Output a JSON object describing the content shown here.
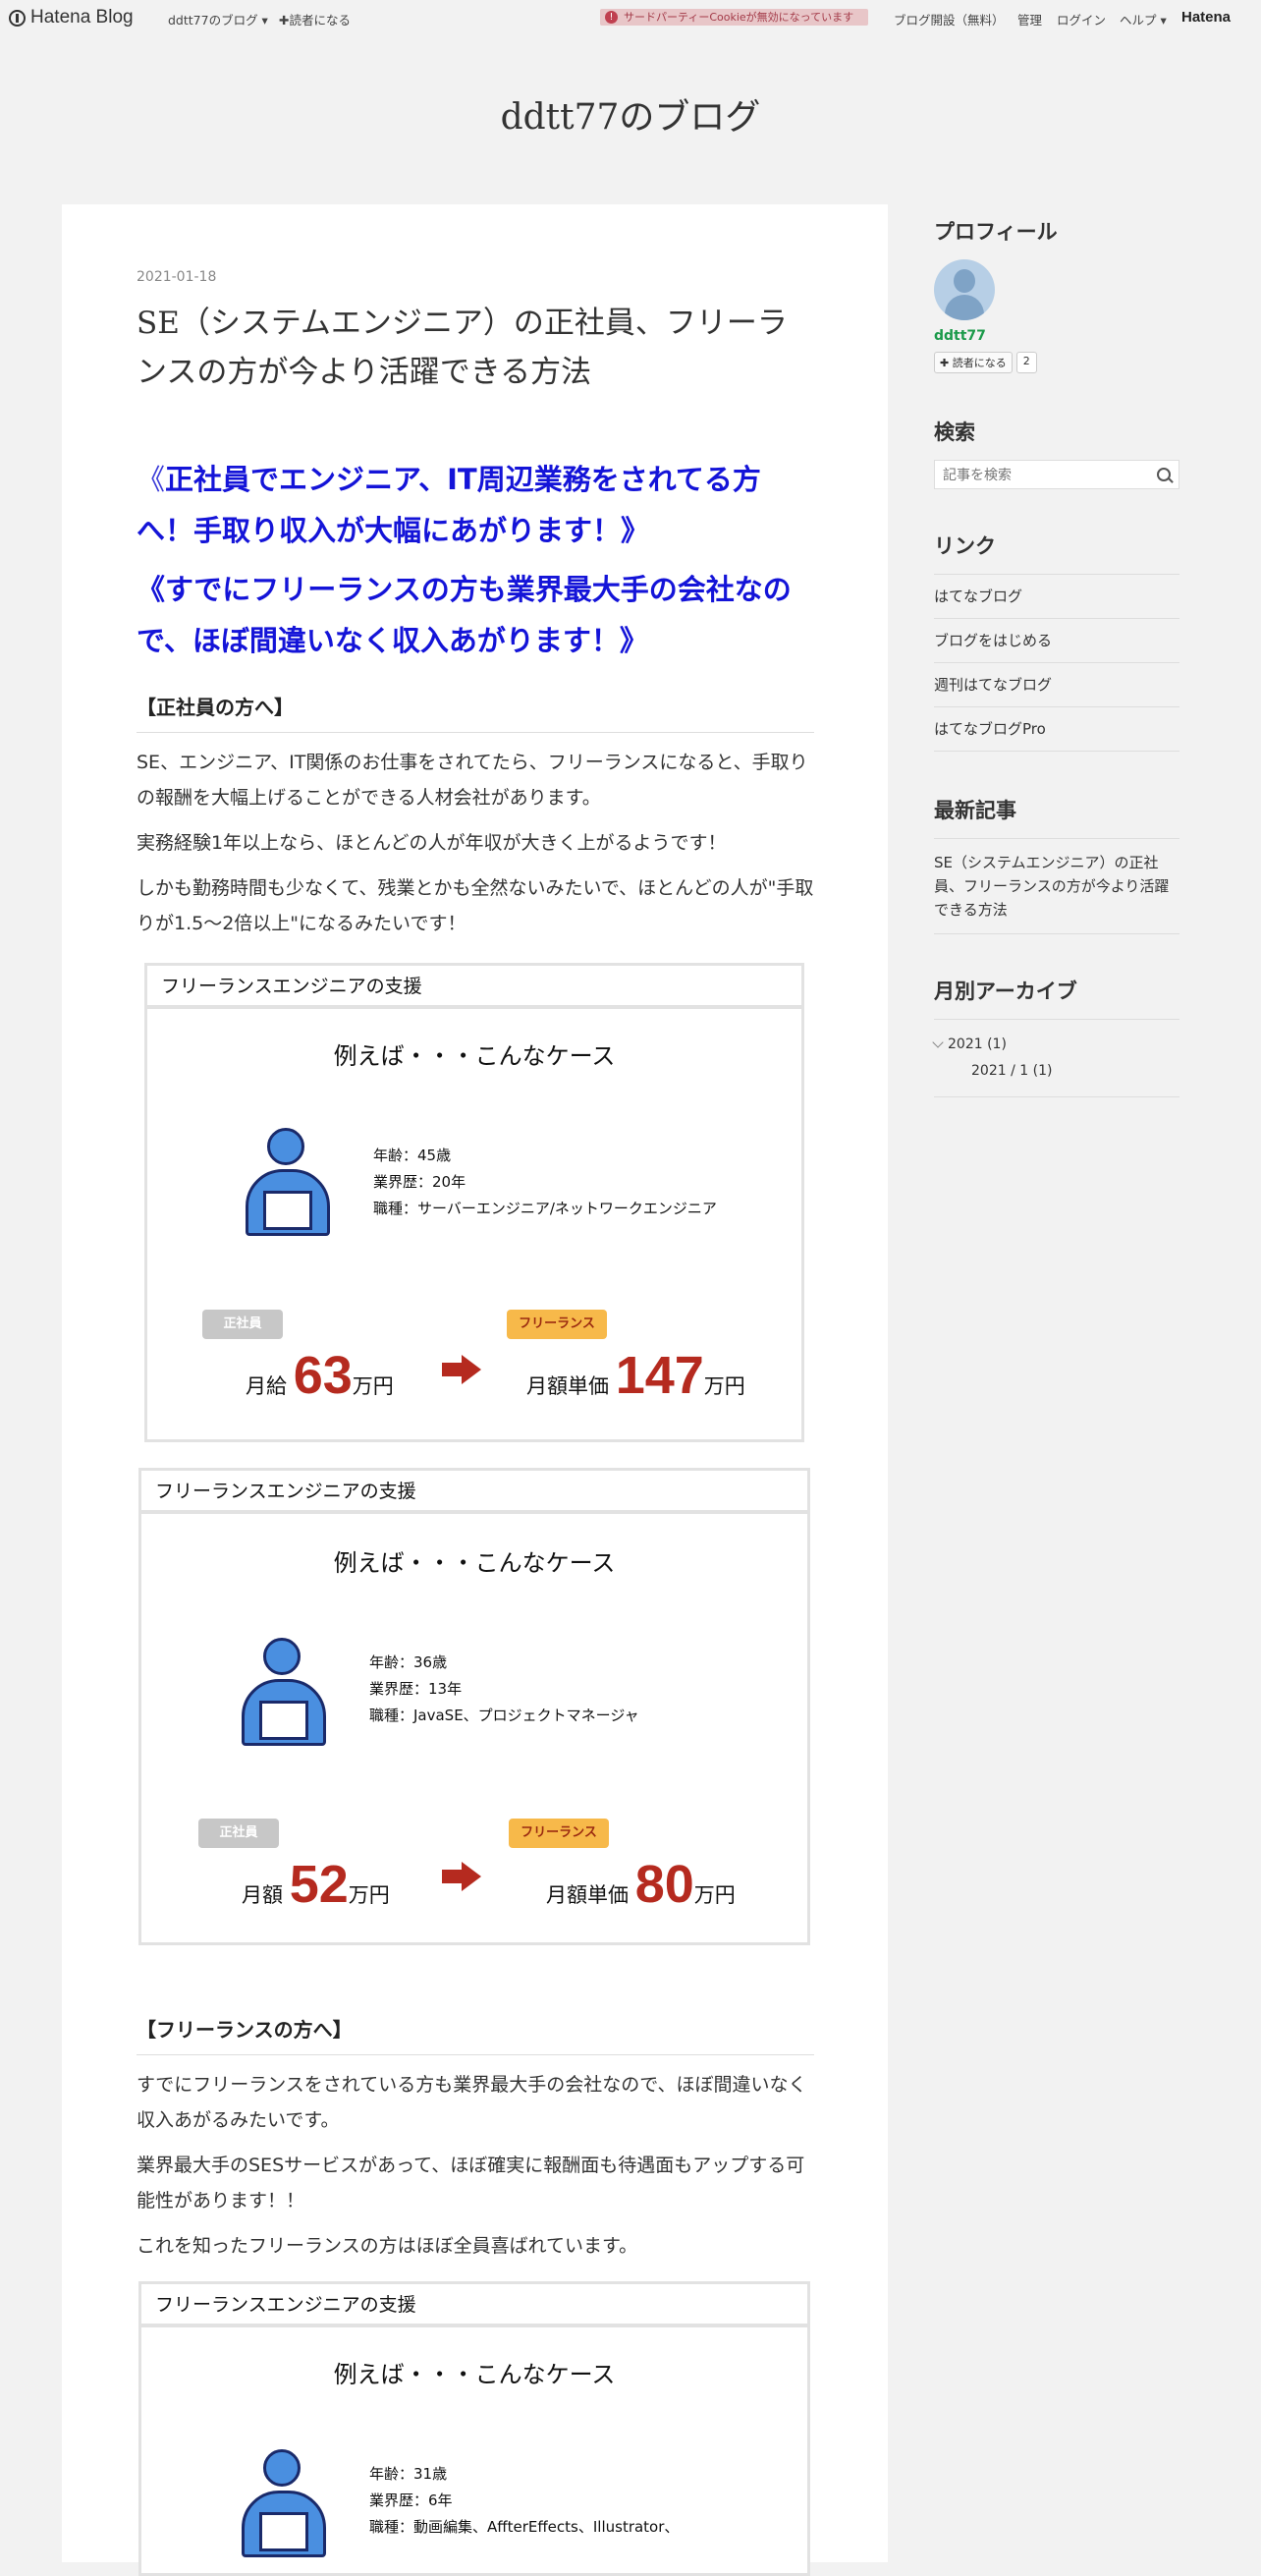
{
  "topbar": {
    "logo_text": "Hatena Blog",
    "blog_menu": "ddtt77のブログ ▾",
    "subscribe": "✚読者になる",
    "cookie_notice": "サードパーティーCookieが無効になっています",
    "create_blog": "ブログ開設（無料）",
    "manage": "管理",
    "login": "ログイン",
    "help": "ヘルプ ▾",
    "hatena": "Hatena"
  },
  "blog": {
    "title": "ddtt77のブログ"
  },
  "entry": {
    "date": "2021-01-18",
    "title": "SE（システムエンジニア）の正社員、フリーランスの方が今より活躍できる方法",
    "lead1_open": "《",
    "lead1": "正社員でエンジニア、IT周辺業務をされてる方へ！手取り収入が大幅にあがります！》",
    "lead2": "《すでにフリーランスの方も業界最大手の会社なので、ほぼ間違いなく収入あがります！》",
    "section1": "【正社員の方へ】",
    "p1": "SE、エンジニア、IT関係のお仕事をされてたら、フリーランスになると、手取りの報酬を大幅上げることができる人材会社があります。",
    "p2": "実務経験1年以上なら、ほとんどの人が年収が大きく上がるようです！",
    "p3": "しかも勤務時間も少なくて、残業とかも全然ないみたいで、ほとんどの人が\"手取りが1.5〜2倍以上\"になるみたいです！",
    "section2": "【フリーランスの方へ】",
    "p4": "すでにフリーランスをされている方も業界最大手の会社なので、ほぼ間違いなく収入あがるみたいです。",
    "p5": "業界最大手のSESサービスがあって、ほぼ確実に報酬面も待遇面もアップする可能性があります！！",
    "p6": "これを知ったフリーランスの方はほぼ全員喜ばれています。"
  },
  "cards": [
    {
      "head": "フリーランスエンジニアの支援",
      "example": "例えば・・・こんなケース",
      "age": "年齢：45歳",
      "exp": "業界歴：20年",
      "job": "職種：サーバーエンジニア/ネットワークエンジニア",
      "tag_before": "正社員",
      "tag_after": "フリーランス",
      "before_label": "月給",
      "before_num": "63",
      "before_unit": "万円",
      "after_label": "月額単価",
      "after_num": "147",
      "after_unit": "万円"
    },
    {
      "head": "フリーランスエンジニアの支援",
      "example": "例えば・・・こんなケース",
      "age": "年齢：36歳",
      "exp": "業界歴：13年",
      "job": "職種：JavaSE、プロジェクトマネージャ",
      "tag_before": "正社員",
      "tag_after": "フリーランス",
      "before_label": "月額",
      "before_num": "52",
      "before_unit": "万円",
      "after_label": "月額単価",
      "after_num": "80",
      "after_unit": "万円"
    },
    {
      "head": "フリーランスエンジニアの支援",
      "example": "例えば・・・こんなケース",
      "age": "年齢：31歳",
      "exp": "業界歴：6年",
      "job": "職種：動画編集、AffterEffects、Illustrator、"
    }
  ],
  "sidebar": {
    "profile_heading": "プロフィール",
    "profile_name": "ddtt77",
    "reader_button": "✚ 読者になる",
    "reader_count": "2",
    "search_heading": "検索",
    "search_placeholder": "記事を検索",
    "links_heading": "リンク",
    "links": [
      "はてなブログ",
      "ブログをはじめる",
      "週刊はてなブログ",
      "はてなブログPro"
    ],
    "recent_heading": "最新記事",
    "recent_item": "SE（システムエンジニア）の正社員、フリーランスの方が今より活躍できる方法",
    "archive_heading": "月別アーカイブ",
    "archive_year": "2021 (1)",
    "archive_month": "2021 / 1 (1)"
  }
}
